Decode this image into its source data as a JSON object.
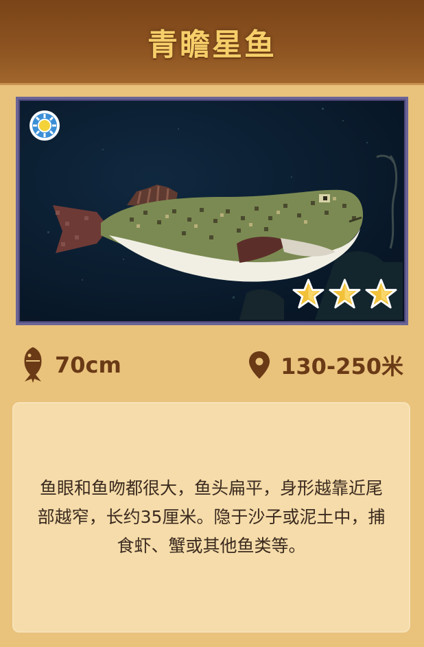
{
  "card": {
    "title": "青瞻星鱼",
    "image": {
      "time_icon": "sun-icon",
      "rarity_stars": 3
    },
    "stats": {
      "size_icon": "fish-icon",
      "size": "70cm",
      "depth_icon": "location-pin-icon",
      "depth": "130-250米"
    },
    "description": "鱼眼和鱼吻都很大，鱼头扁平，身形越靠近尾部越窄，长约35厘米。隐于沙子或泥土中，捕食虾、蟹或其他鱼类等。"
  },
  "colors": {
    "header": "#8c5220",
    "title": "#f6cf6a",
    "background": "#e9c27c",
    "text_brown": "#6a3a16",
    "desc_box": "#f5dcaa"
  }
}
